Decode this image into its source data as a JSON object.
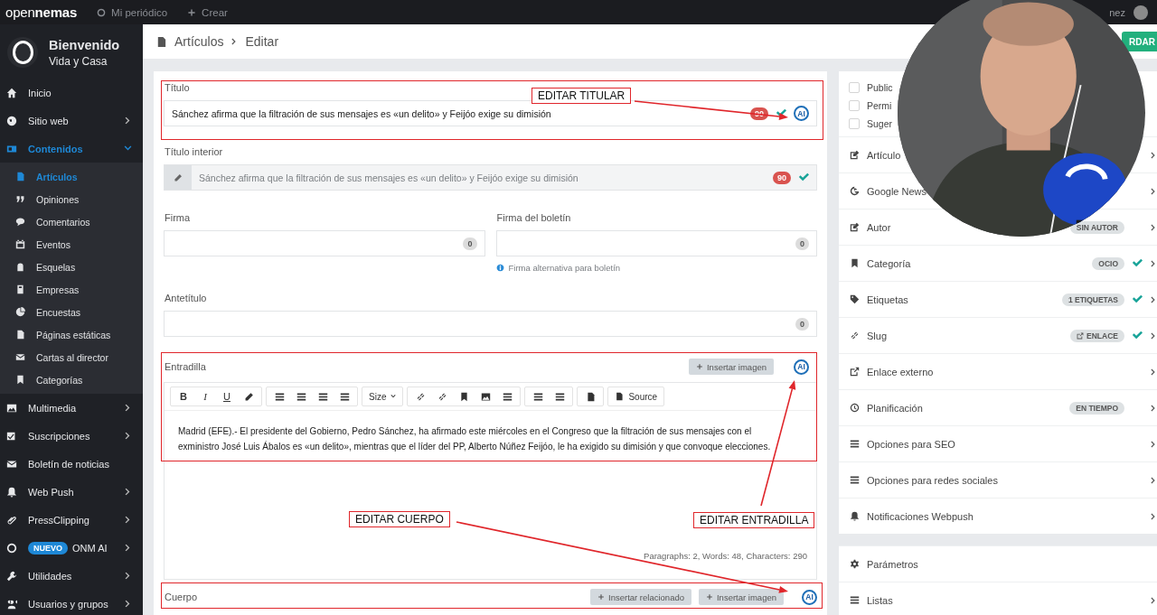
{
  "topbar": {
    "logo_light": "open",
    "logo_bold": "nemas",
    "links": [
      {
        "label": "Mi periódico"
      },
      {
        "label": "Crear"
      }
    ],
    "user": "nez"
  },
  "sidebar": {
    "title": "Bienvenido",
    "subtitle": "Vida y Casa",
    "items": [
      {
        "label": "Inicio",
        "expandable": false,
        "expanded": false,
        "selected": false
      },
      {
        "label": "Sitio web",
        "expandable": true,
        "expanded": false,
        "selected": false
      },
      {
        "label": "Contenidos",
        "expandable": true,
        "expanded": true,
        "selected": true,
        "children": [
          {
            "label": "Artículos",
            "selected": true
          },
          {
            "label": "Opiniones",
            "selected": false
          },
          {
            "label": "Comentarios",
            "selected": false
          },
          {
            "label": "Eventos",
            "selected": false
          },
          {
            "label": "Esquelas",
            "selected": false
          },
          {
            "label": "Empresas",
            "selected": false
          },
          {
            "label": "Encuestas",
            "selected": false
          },
          {
            "label": "Páginas estáticas",
            "selected": false
          },
          {
            "label": "Cartas al director",
            "selected": false
          },
          {
            "label": "Categorías",
            "selected": false
          }
        ]
      },
      {
        "label": "Multimedia",
        "expandable": true,
        "expanded": false,
        "selected": false
      },
      {
        "label": "Suscripciones",
        "expandable": true,
        "expanded": false,
        "selected": false
      },
      {
        "label": "Boletín de noticias",
        "expandable": false,
        "expanded": false,
        "selected": false
      },
      {
        "label": "Web Push",
        "expandable": true,
        "expanded": false,
        "selected": false
      },
      {
        "label": "PressClipping",
        "expandable": true,
        "expanded": false,
        "selected": false
      },
      {
        "label": "ONM AI",
        "badge": "NUEVO",
        "expandable": true,
        "expanded": false,
        "selected": false
      },
      {
        "label": "Utilidades",
        "expandable": true,
        "expanded": false,
        "selected": false
      },
      {
        "label": "Usuarios y grupos",
        "expandable": true,
        "expanded": false,
        "selected": false
      }
    ]
  },
  "breadcrumb": [
    "Artículos",
    "Editar"
  ],
  "save_button": "RDAR",
  "form": {
    "title": {
      "label": "Título",
      "value": "Sánchez afirma que la filtración de sus mensajes es «un delito» y Feijóo exige su dimisión",
      "count": "90",
      "valid": true,
      "ai_icon": "AI"
    },
    "inner_title": {
      "label": "Título interior",
      "placeholder": "Sánchez afirma que la filtración de sus mensajes es «un delito» y Feijóo exige su dimisión",
      "count": "90",
      "valid": true
    },
    "signature": {
      "label": "Firma",
      "count": "0"
    },
    "newsletter_signature": {
      "label": "Firma del boletín",
      "count": "0",
      "help": "Firma alternativa para boletín"
    },
    "pretitle": {
      "label": "Antetítulo",
      "count": "0"
    },
    "lead": {
      "label": "Entradilla",
      "insert_button": "Insertar imagen",
      "ai_icon": "AI",
      "toolbar": {
        "bold": "B",
        "italic": "I",
        "underline": "U",
        "size": "Size",
        "source": "Source"
      },
      "text": "Madrid (EFE).- El presidente del Gobierno, Pedro Sánchez, ha afirmado este miércoles en el Congreso que la filtración de sus mensajes con el exministro José Luis Ábalos es «un delito», mientras que el líder del PP, Alberto Núñez Feijóo, le ha exigido su dimisión y que convoque elecciones.",
      "status": "Paragraphs: 2, Words: 48, Characters: 290"
    },
    "body": {
      "label": "Cuerpo",
      "buttons": [
        "Insertar relacionado",
        "Insertar imagen"
      ],
      "ai_icon": "AI"
    }
  },
  "side_panel": {
    "options": [
      {
        "label": "Public",
        "checked": false
      },
      {
        "label": "Permi",
        "checked": false
      },
      {
        "label": "Suger",
        "checked": false
      }
    ],
    "sections": [
      {
        "label": "Artículo",
        "valid": false,
        "expandable": true
      },
      {
        "label": "Google News",
        "valid": false,
        "expandable": true
      },
      {
        "label": "Autor",
        "badge": "SIN AUTOR",
        "badge_icon": false,
        "valid": false,
        "expandable": true
      },
      {
        "label": "Categoría",
        "badge": "OCIO",
        "badge_icon": false,
        "valid": true,
        "expandable": true
      },
      {
        "label": "Etiquetas",
        "badge": "1 ETIQUETAS",
        "badge_icon": false,
        "valid": true,
        "expandable": true
      },
      {
        "label": "Slug",
        "badge": "ENLACE",
        "badge_icon": true,
        "valid": true,
        "expandable": true
      },
      {
        "label": "Enlace externo",
        "valid": false,
        "expandable": true
      },
      {
        "label": "Planificación",
        "badge": "EN TIEMPO",
        "badge_icon": false,
        "valid": false,
        "expandable": true
      },
      {
        "label": "Opciones para SEO",
        "valid": false,
        "expandable": true
      },
      {
        "label": "Opciones para redes sociales",
        "valid": false,
        "expandable": true
      },
      {
        "label": "Notificaciones Webpush",
        "valid": false,
        "expandable": true
      }
    ],
    "settings": [
      {
        "label": "Parámetros",
        "expandable": false
      },
      {
        "label": "Listas",
        "expandable": true
      }
    ]
  },
  "annotations": [
    {
      "label": "EDITAR TITULAR"
    },
    {
      "label": "EDITAR CUERPO"
    },
    {
      "label": "EDITAR ENTRADILLA"
    }
  ]
}
